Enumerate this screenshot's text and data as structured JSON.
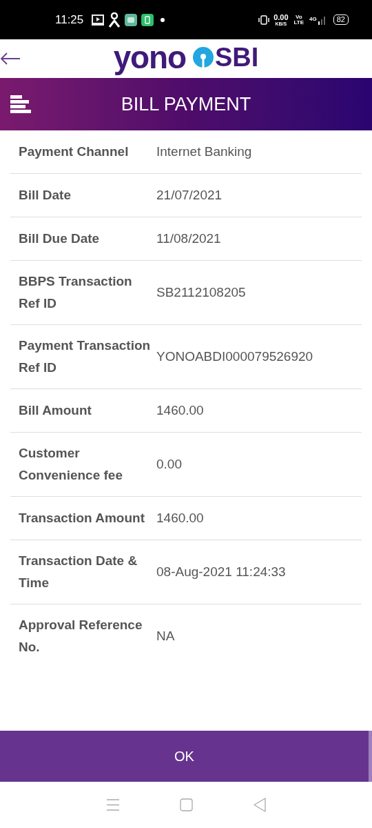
{
  "status_bar": {
    "time": "11:25",
    "speed": "0.00",
    "speed_unit": "KB/S",
    "volte": "Vo",
    "volte_sub": "LTE",
    "network": "4G",
    "battery": "82"
  },
  "logo": {
    "word": "yono",
    "bank": "SBI"
  },
  "header": {
    "title": "BILL PAYMENT"
  },
  "details": [
    {
      "label": "Payment Channel",
      "value": "Internet Banking"
    },
    {
      "label": "Bill Date",
      "value": "21/07/2021"
    },
    {
      "label": "Bill Due Date",
      "value": "11/08/2021"
    },
    {
      "label": "BBPS Transaction Ref ID",
      "value": "SB2112108205"
    },
    {
      "label": "Payment Transaction Ref ID",
      "value": "YONOABDI000079526920"
    },
    {
      "label": "Bill Amount",
      "value": "1460.00"
    },
    {
      "label": "Customer Convenience fee",
      "value": "0.00"
    },
    {
      "label": "Transaction Amount",
      "value": "1460.00"
    },
    {
      "label": "Transaction Date & Time",
      "value": "08-Aug-2021 11:24:33"
    },
    {
      "label": "Approval Reference No.",
      "value": "NA"
    }
  ],
  "button": "OK"
}
